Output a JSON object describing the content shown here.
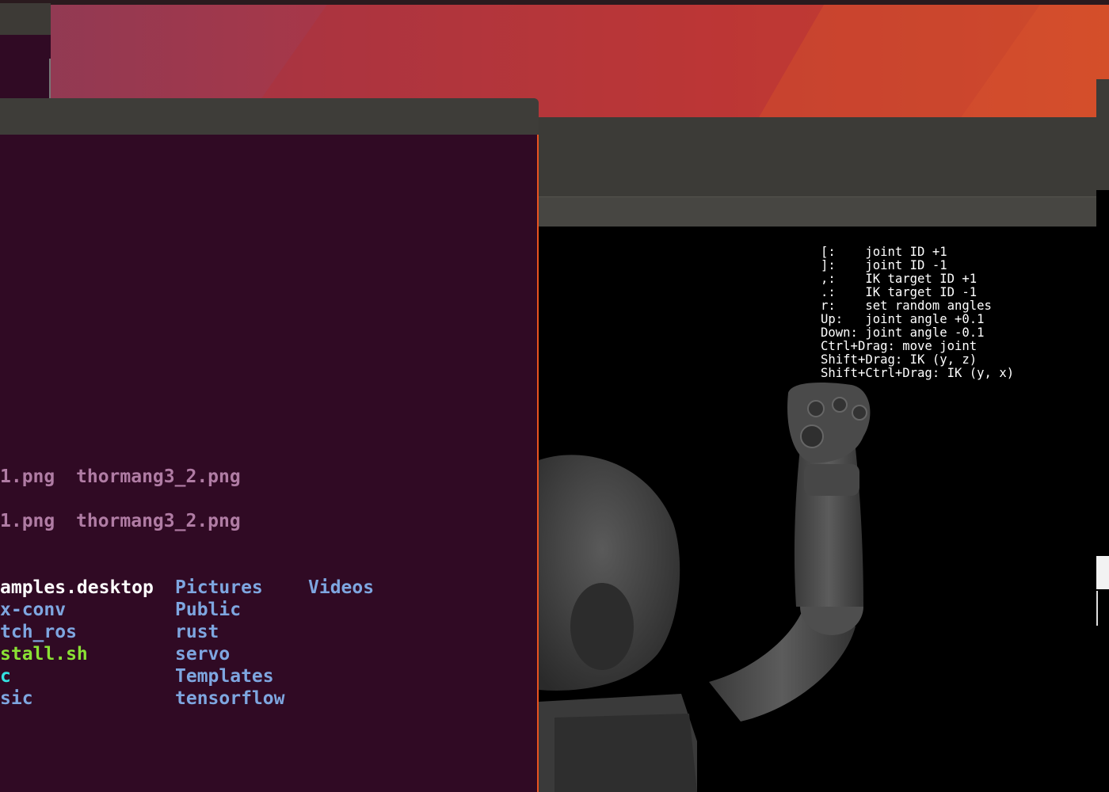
{
  "viewer": {
    "help_lines": [
      "[:    joint ID +1",
      "]:    joint ID -1",
      ",:    IK target ID +1",
      ".:    IK target ID -1",
      "r:    set random angles",
      "Up:   joint angle +0.1",
      "Down: joint angle -0.1",
      "Ctrl+Drag: move joint",
      "Shift+Drag: IK (y, z)",
      "Shift+Ctrl+Drag: IK (y, x)"
    ]
  },
  "terminal": {
    "image_rows": [
      {
        "first": "1.png",
        "second": "thormang3_2.png"
      },
      {
        "first": "1.png",
        "second": "thormang3_2.png"
      }
    ],
    "listing_col1": [
      {
        "text": "amples.desktop",
        "kind": "file"
      },
      {
        "text": "x-conv",
        "kind": "dir"
      },
      {
        "text": "tch_ros",
        "kind": "dir"
      },
      {
        "text": "stall.sh",
        "kind": "exe"
      },
      {
        "text": "c",
        "kind": "link"
      },
      {
        "text": "sic",
        "kind": "dir"
      }
    ],
    "listing_col2": [
      "Pictures",
      "Public",
      "rust",
      "servo",
      "Templates",
      "tensorflow"
    ],
    "listing_col3": [
      "Videos"
    ]
  },
  "colors": {
    "terminal_bg": "#300a24",
    "image_file": "#b07ca4",
    "directory": "#7ea6e0",
    "executable": "#8ae234",
    "symlink": "#34e2e2",
    "accent": "#e95420"
  }
}
